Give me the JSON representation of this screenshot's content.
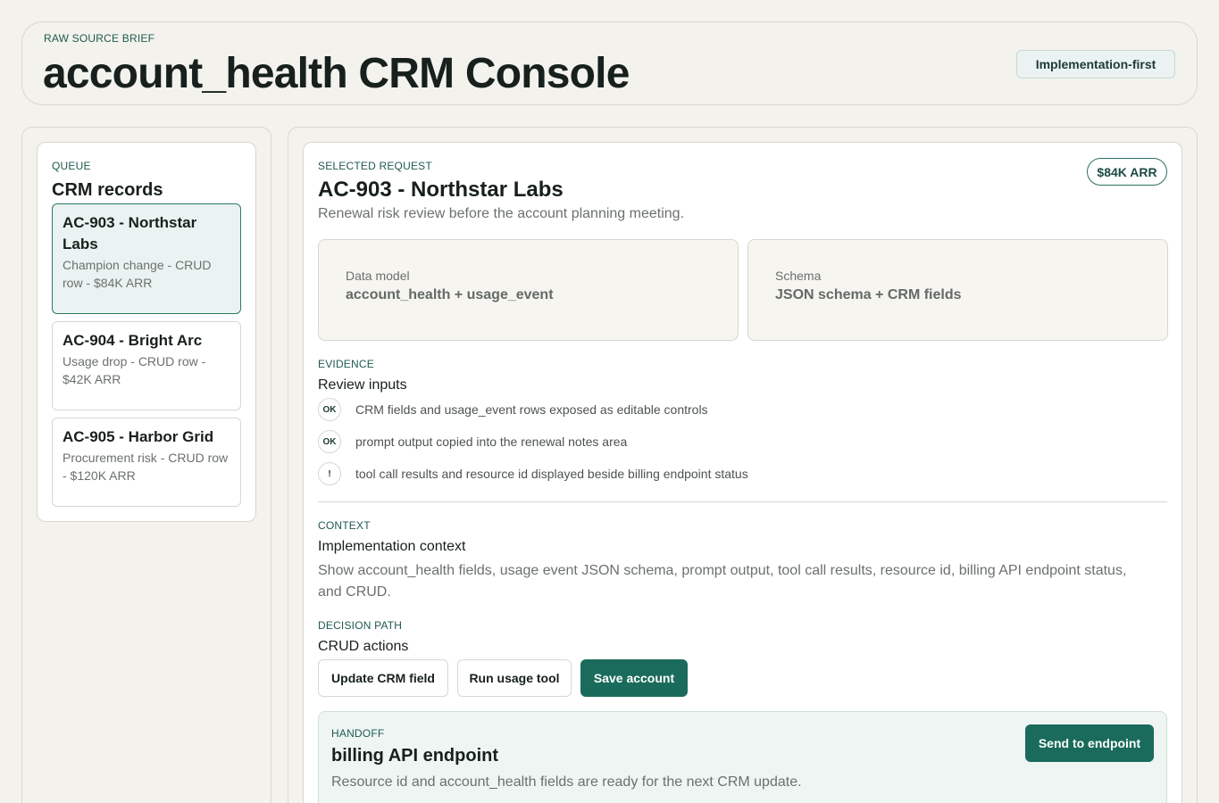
{
  "header": {
    "eyebrow": "RAW SOURCE BRIEF",
    "title": "account_health CRM Console",
    "badge": "Implementation-first"
  },
  "sidebar": {
    "eyebrow": "QUEUE",
    "title": "CRM records",
    "records": [
      {
        "title": "AC-903 - Northstar Labs",
        "subtitle": "Champion change - CRUD row - $84K ARR",
        "active": true
      },
      {
        "title": "AC-904 - Bright Arc",
        "subtitle": "Usage drop - CRUD row - $42K ARR",
        "active": false
      },
      {
        "title": "AC-905 - Harbor Grid",
        "subtitle": "Procurement risk - CRUD row - $120K ARR",
        "active": false
      }
    ]
  },
  "main": {
    "eyebrow": "SELECTED REQUEST",
    "title": "AC-903 - Northstar Labs",
    "subtitle": "Renewal risk review before the account planning meeting.",
    "arr_pill": "$84K ARR",
    "cards": [
      {
        "label": "Data model",
        "value": "account_health + usage_event"
      },
      {
        "label": "Schema",
        "value": "JSON schema + CRM fields"
      }
    ],
    "evidence": {
      "eyebrow": "EVIDENCE",
      "title": "Review inputs",
      "items": [
        {
          "badge": "OK",
          "text": "CRM fields and usage_event rows exposed as editable controls"
        },
        {
          "badge": "OK",
          "text": "prompt output copied into the renewal notes area"
        },
        {
          "badge": "!",
          "text": "tool call results and resource id displayed beside billing endpoint status"
        }
      ]
    },
    "context": {
      "eyebrow": "CONTEXT",
      "title": "Implementation context",
      "body": "Show account_health fields, usage event JSON schema, prompt output, tool call results, resource id, billing API endpoint status, and CRUD."
    },
    "decision": {
      "eyebrow": "DECISION PATH",
      "title": "CRUD actions",
      "buttons": [
        "Update CRM field",
        "Run usage tool",
        "Save account"
      ]
    },
    "handoff": {
      "eyebrow": "HANDOFF",
      "title": "billing API endpoint",
      "subtitle": "Resource id and account_health fields are ready for the next CRM update.",
      "button": "Send to endpoint"
    }
  }
}
